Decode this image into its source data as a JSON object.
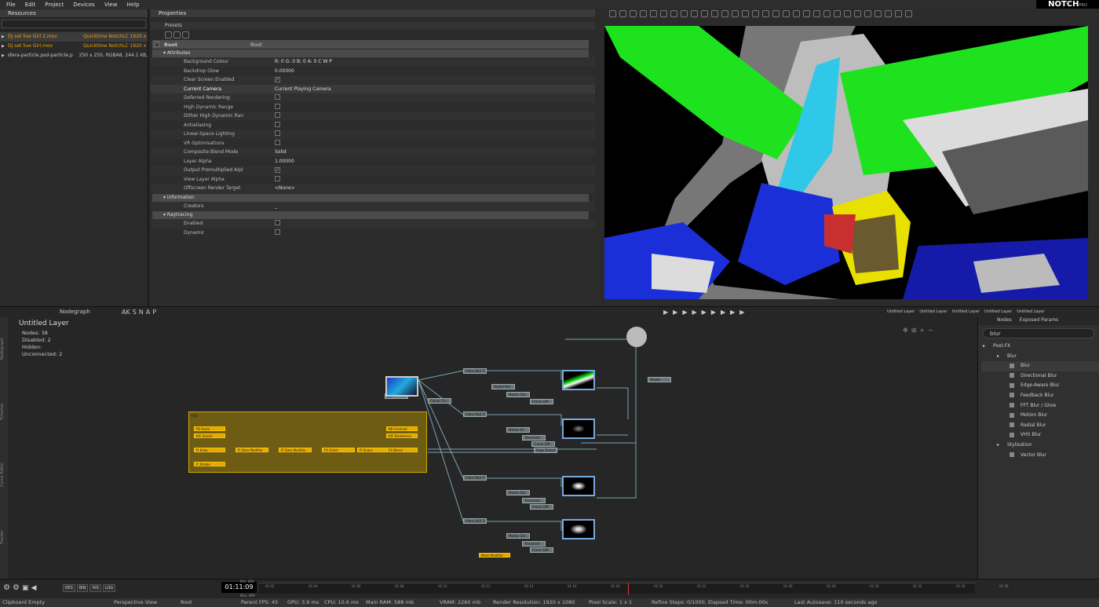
{
  "menu": [
    "File",
    "Edit",
    "Project",
    "Devices",
    "View",
    "Help"
  ],
  "brand": {
    "name": "NOTCH",
    "edition": "PRO"
  },
  "resources": {
    "title": "Resources",
    "items": [
      {
        "name": "Dj set live Girl 2.mov",
        "type": "Quicktime NotchLC 1920 x"
      },
      {
        "name": "Dj set live Girl.mov",
        "type": "Quicktime NotchLC 1920 x"
      },
      {
        "name": "sfera-particle.psd-particle.p",
        "type": "250 x 250, RGBA8, 244.1 kB,"
      }
    ]
  },
  "properties": {
    "title": "Properties",
    "presets": "Presets",
    "root_label": "Root",
    "root_value": "Root",
    "sections": {
      "attributes": "Attributes",
      "information": "Information",
      "raytracing": "Raytracing"
    },
    "attributes": [
      {
        "label": "Background Colour",
        "value": "R: 0 G: 0 B: 0 A: 0       C    W    P"
      },
      {
        "label": "Backdrop Glow",
        "value": "0.00000"
      },
      {
        "label": "Clear Screen Enabled",
        "value": "✓"
      },
      {
        "label": "Current Camera",
        "value": "Current Playing Camera"
      },
      {
        "label": "Deferred Rendering",
        "value": ""
      },
      {
        "label": "High Dynamic Range",
        "value": ""
      },
      {
        "label": "Dither High Dynamic Ran",
        "value": ""
      },
      {
        "label": "Antialiasing",
        "value": ""
      },
      {
        "label": "Linear-Space Lighting",
        "value": ""
      },
      {
        "label": "VR Optimisations",
        "value": ""
      },
      {
        "label": "Composite Blend Mode",
        "value": "Solid"
      },
      {
        "label": "Layer Alpha",
        "value": "1.00000"
      },
      {
        "label": "Output Premultiplied Alpl",
        "value": "✓"
      },
      {
        "label": "View Layer Alpha",
        "value": ""
      },
      {
        "label": "Offscreen Render Target",
        "value": "<None>"
      }
    ],
    "information": [
      {
        "label": "Creators",
        "value": "_"
      }
    ],
    "raytracing": [
      {
        "label": "Enabled",
        "value": ""
      },
      {
        "label": "Dynamic",
        "value": ""
      }
    ]
  },
  "nodegraph": {
    "tab": "Nodegraph",
    "toolbar_letters": [
      "AK",
      "S",
      "N",
      "A",
      "P"
    ],
    "layer_title": "Untitled  Layer",
    "stats": [
      "Nodes:  38",
      "Disabled:  2",
      "Hidden:",
      "Unconnected:  2"
    ],
    "side_tabs": [
      "Nodegraph",
      "Timeline",
      "Curve Editor",
      "Tracker"
    ],
    "group_label": "MIDI",
    "yellow_nodes": [
      "FB Scale",
      "KIC Speed",
      "FI Edge",
      "FI Data Modifier",
      "FI Data Modifier",
      "FX Glitch",
      "FI Snare",
      "F: Strobe",
      "BB Contrast",
      "KIC Brightness",
      "FX Blend",
      "Mesh Modifier"
    ],
    "grey_nodes": [
      "Video NLE Tr..",
      "Digital Mix..",
      "Motion Del..",
      "Frame Diff..",
      "Colour Cor..",
      "Video NLE Tr..",
      "Motion Bl..",
      "Threshold",
      "Frame Diff..",
      "Edge Detect",
      "Video NLE Tr..",
      "Motion Del..",
      "Threshold",
      "Frame Diff..",
      "Video NLE Tr..",
      "Motion Del..",
      "Threshold",
      "Frame Diff..",
      "Strobe",
      "Cru"
    ]
  },
  "viewport_tabs": [
    "Untitled Layer",
    "Untitled Layer",
    "Untitled Layer",
    "Untitled Layer",
    "Untitled Layer"
  ],
  "nodes_panel": {
    "tabs": [
      "Nodes",
      "Exposed Params"
    ],
    "search": "blur",
    "tree": [
      {
        "label": "Post-FX",
        "level": 0,
        "arrow": "▸"
      },
      {
        "label": "Blur",
        "level": 1,
        "arrow": "▸"
      },
      {
        "label": "Blur",
        "level": 2
      },
      {
        "label": "Directional Blur",
        "level": 2
      },
      {
        "label": "Edge-Aware Blur",
        "level": 2
      },
      {
        "label": "Feedback Blur",
        "level": 2
      },
      {
        "label": "FFT Blur / Glow",
        "level": 2
      },
      {
        "label": "Motion Blur",
        "level": 2
      },
      {
        "label": "Radial Blur",
        "level": 2
      },
      {
        "label": "VHS Blur",
        "level": 2
      },
      {
        "label": "Stylisation",
        "level": 1,
        "arrow": "▸"
      },
      {
        "label": "Vector Blur",
        "level": 2
      }
    ]
  },
  "timeline": {
    "buttons": [
      "RES",
      "BIN",
      "HIS",
      "LOG"
    ],
    "timecode": "01:11:09",
    "min": "Min: 000",
    "max": "Max: 999",
    "ticks": [
      "01:02",
      "01:04",
      "01:06",
      "01:08",
      "01:10",
      "01:12",
      "01:14",
      "01:16",
      "01:18",
      "01:20",
      "01:22",
      "01:24",
      "01:26",
      "01:28",
      "01:30",
      "01:32",
      "01:34",
      "01:36"
    ]
  },
  "status": {
    "left": "Clipboard Empty",
    "camera": "Perspective View",
    "layer": "Root",
    "parent": "Parent",
    "fps": "FPS: 45",
    "gpu": "GPU: 3.9 ms",
    "cpu": "CPU: 10.6 ms",
    "ram": "Main RAM: 588 mb",
    "vram": "VRAM: 2260 mb",
    "res": "Render Resolution: 1920 x 1080",
    "scale": "Pixel Scale: 1 x 1",
    "refine": "Refine Steps: 0/1000, Elapsed Time: 00m:00s",
    "autosave": "Last Autosave: 110 seconds ago"
  }
}
